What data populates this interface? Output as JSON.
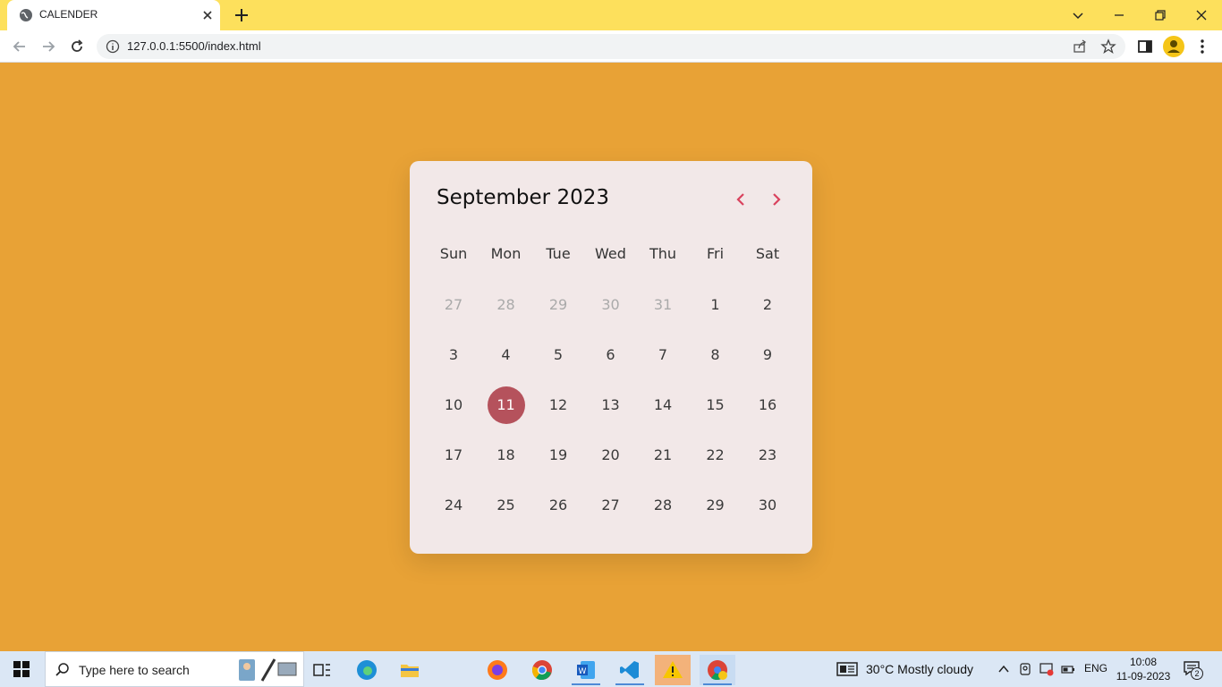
{
  "browser": {
    "tab_title": "CALENDER",
    "url": "127.0.0.1:5500/index.html"
  },
  "calendar": {
    "title": "September 2023",
    "weekdays": [
      "Sun",
      "Mon",
      "Tue",
      "Wed",
      "Thu",
      "Fri",
      "Sat"
    ],
    "weeks": [
      [
        {
          "d": "27",
          "s": "inactive"
        },
        {
          "d": "28",
          "s": "inactive"
        },
        {
          "d": "29",
          "s": "inactive"
        },
        {
          "d": "30",
          "s": "inactive"
        },
        {
          "d": "31",
          "s": "inactive"
        },
        {
          "d": "1",
          "s": ""
        },
        {
          "d": "2",
          "s": ""
        }
      ],
      [
        {
          "d": "3",
          "s": ""
        },
        {
          "d": "4",
          "s": ""
        },
        {
          "d": "5",
          "s": ""
        },
        {
          "d": "6",
          "s": ""
        },
        {
          "d": "7",
          "s": ""
        },
        {
          "d": "8",
          "s": ""
        },
        {
          "d": "9",
          "s": ""
        }
      ],
      [
        {
          "d": "10",
          "s": ""
        },
        {
          "d": "11",
          "s": "today"
        },
        {
          "d": "12",
          "s": ""
        },
        {
          "d": "13",
          "s": ""
        },
        {
          "d": "14",
          "s": ""
        },
        {
          "d": "15",
          "s": ""
        },
        {
          "d": "16",
          "s": ""
        }
      ],
      [
        {
          "d": "17",
          "s": ""
        },
        {
          "d": "18",
          "s": ""
        },
        {
          "d": "19",
          "s": ""
        },
        {
          "d": "20",
          "s": ""
        },
        {
          "d": "21",
          "s": ""
        },
        {
          "d": "22",
          "s": ""
        },
        {
          "d": "23",
          "s": ""
        }
      ],
      [
        {
          "d": "24",
          "s": ""
        },
        {
          "d": "25",
          "s": ""
        },
        {
          "d": "26",
          "s": ""
        },
        {
          "d": "27",
          "s": ""
        },
        {
          "d": "28",
          "s": ""
        },
        {
          "d": "29",
          "s": ""
        },
        {
          "d": "30",
          "s": ""
        }
      ]
    ],
    "colors": {
      "background": "#e8a236",
      "card": "#f2e8e8",
      "accent": "#b5525c",
      "nav": "#d9435e"
    }
  },
  "taskbar": {
    "search_placeholder": "Type here to search",
    "weather": "30°C  Mostly cloudy",
    "language": "ENG",
    "time": "10:08",
    "date": "11-09-2023",
    "notifications": "2"
  }
}
